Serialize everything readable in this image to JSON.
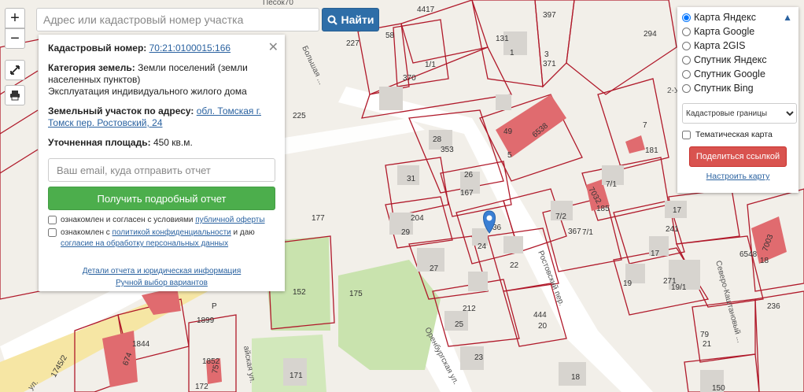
{
  "search": {
    "placeholder": "Адрес или кадастровый номер участка",
    "button_label": "Найти"
  },
  "zoom": {
    "in": "+",
    "out": "−"
  },
  "info_panel": {
    "cadastral_label": "Кадастровый номер:",
    "cadastral_value": "70:21:0100015:166",
    "category_label": "Категория земель:",
    "category_value": "Земли поселений (земли населенных пунктов)",
    "usage": "Эксплуатация индивидуального жилого дома",
    "address_label": "Земельный участок по адресу:",
    "address_value": "обл. Томская г. Томск пер. Ростовский, 24",
    "area_label": "Уточненная площадь:",
    "area_value": "450 кв.м.",
    "email_placeholder": "Ваш email, куда отправить отчет",
    "report_button": "Получить подробный отчет",
    "agree1_text": "ознакомлен и согласен с условиями",
    "agree1_link": "публичной оферты",
    "agree2_text": "ознакомлен с",
    "agree2_link": "политикой конфиденциальности",
    "agree2_mid": "и даю",
    "agree2_link2": "согласие на обработку персональных данных",
    "details_link": "Детали отчета и юридическая информация",
    "manual_link": "Ручной выбор вариантов"
  },
  "layers": {
    "options": [
      "Карта Яндекс",
      "Карта Google",
      "Карта 2GIS",
      "Спутник Яндекс",
      "Спутник Google",
      "Спутник Bing"
    ],
    "selected": "Карта Яндекс",
    "select_value": "Кадастровые границы",
    "thematic": "Тематическая карта",
    "share_button": "Поделиться ссылкой",
    "configure_link": "Настроить карту"
  },
  "map_labels": {
    "n4417": "4417",
    "n397": "397",
    "n58": "58",
    "n227": "227",
    "n131": "131",
    "n1": "1",
    "n294": "294",
    "n3": "3",
    "n371": "371",
    "n1_1": "1/1",
    "n370": "370",
    "n225": "225",
    "n49": "49",
    "n6538": "6538",
    "n7": "7",
    "n181": "181",
    "n5": "5",
    "n28": "28",
    "n353": "353",
    "n31": "31",
    "n26": "26",
    "n167": "167",
    "n7_1a": "7/1",
    "n7032": "7032",
    "n185": "185",
    "n17a": "17",
    "n204": "204",
    "n29": "29",
    "n177": "177",
    "n36": "36",
    "n24": "24",
    "n7_2": "7/2",
    "n367": "367",
    "n7_1b": "7/1",
    "n241": "241",
    "n6548": "6548",
    "n7003": "7003",
    "n18": "18",
    "n17b": "17",
    "n27": "27",
    "n22": "22",
    "n19": "19",
    "n271": "271",
    "n19_1": "19/1",
    "n152": "152",
    "n175": "175",
    "n1899": "1899",
    "nP": "P",
    "n212": "212",
    "n25": "25",
    "n444": "444",
    "n20": "20",
    "n236": "236",
    "n1844": "1844",
    "n674": "674",
    "n79": "79",
    "n21": "21",
    "n1852": "1852",
    "n75": "75",
    "n172": "172",
    "n171": "171",
    "n23": "23",
    "n18b": "18",
    "n150": "150",
    "n1745": "1745/2",
    "n5_b": "5",
    "st_bolshaya": "Большая ...",
    "st_rostovsky": "Ростовский пер.",
    "st_orenburg": "Оренбургская ул.",
    "st_severo": "Северо-Каштановый ...",
    "st_ul": "ул.",
    "st_ay": "айская ул.",
    "st_pesok": "Песок70",
    "st_2u": "2-У"
  },
  "colors": {
    "parcel_border": "#b0192a",
    "building_red": "#e06b6f",
    "green": "#c9e3ae",
    "accent_blue": "#2e6ea8",
    "report_green": "#4cae4c",
    "share_red": "#d9534f"
  }
}
